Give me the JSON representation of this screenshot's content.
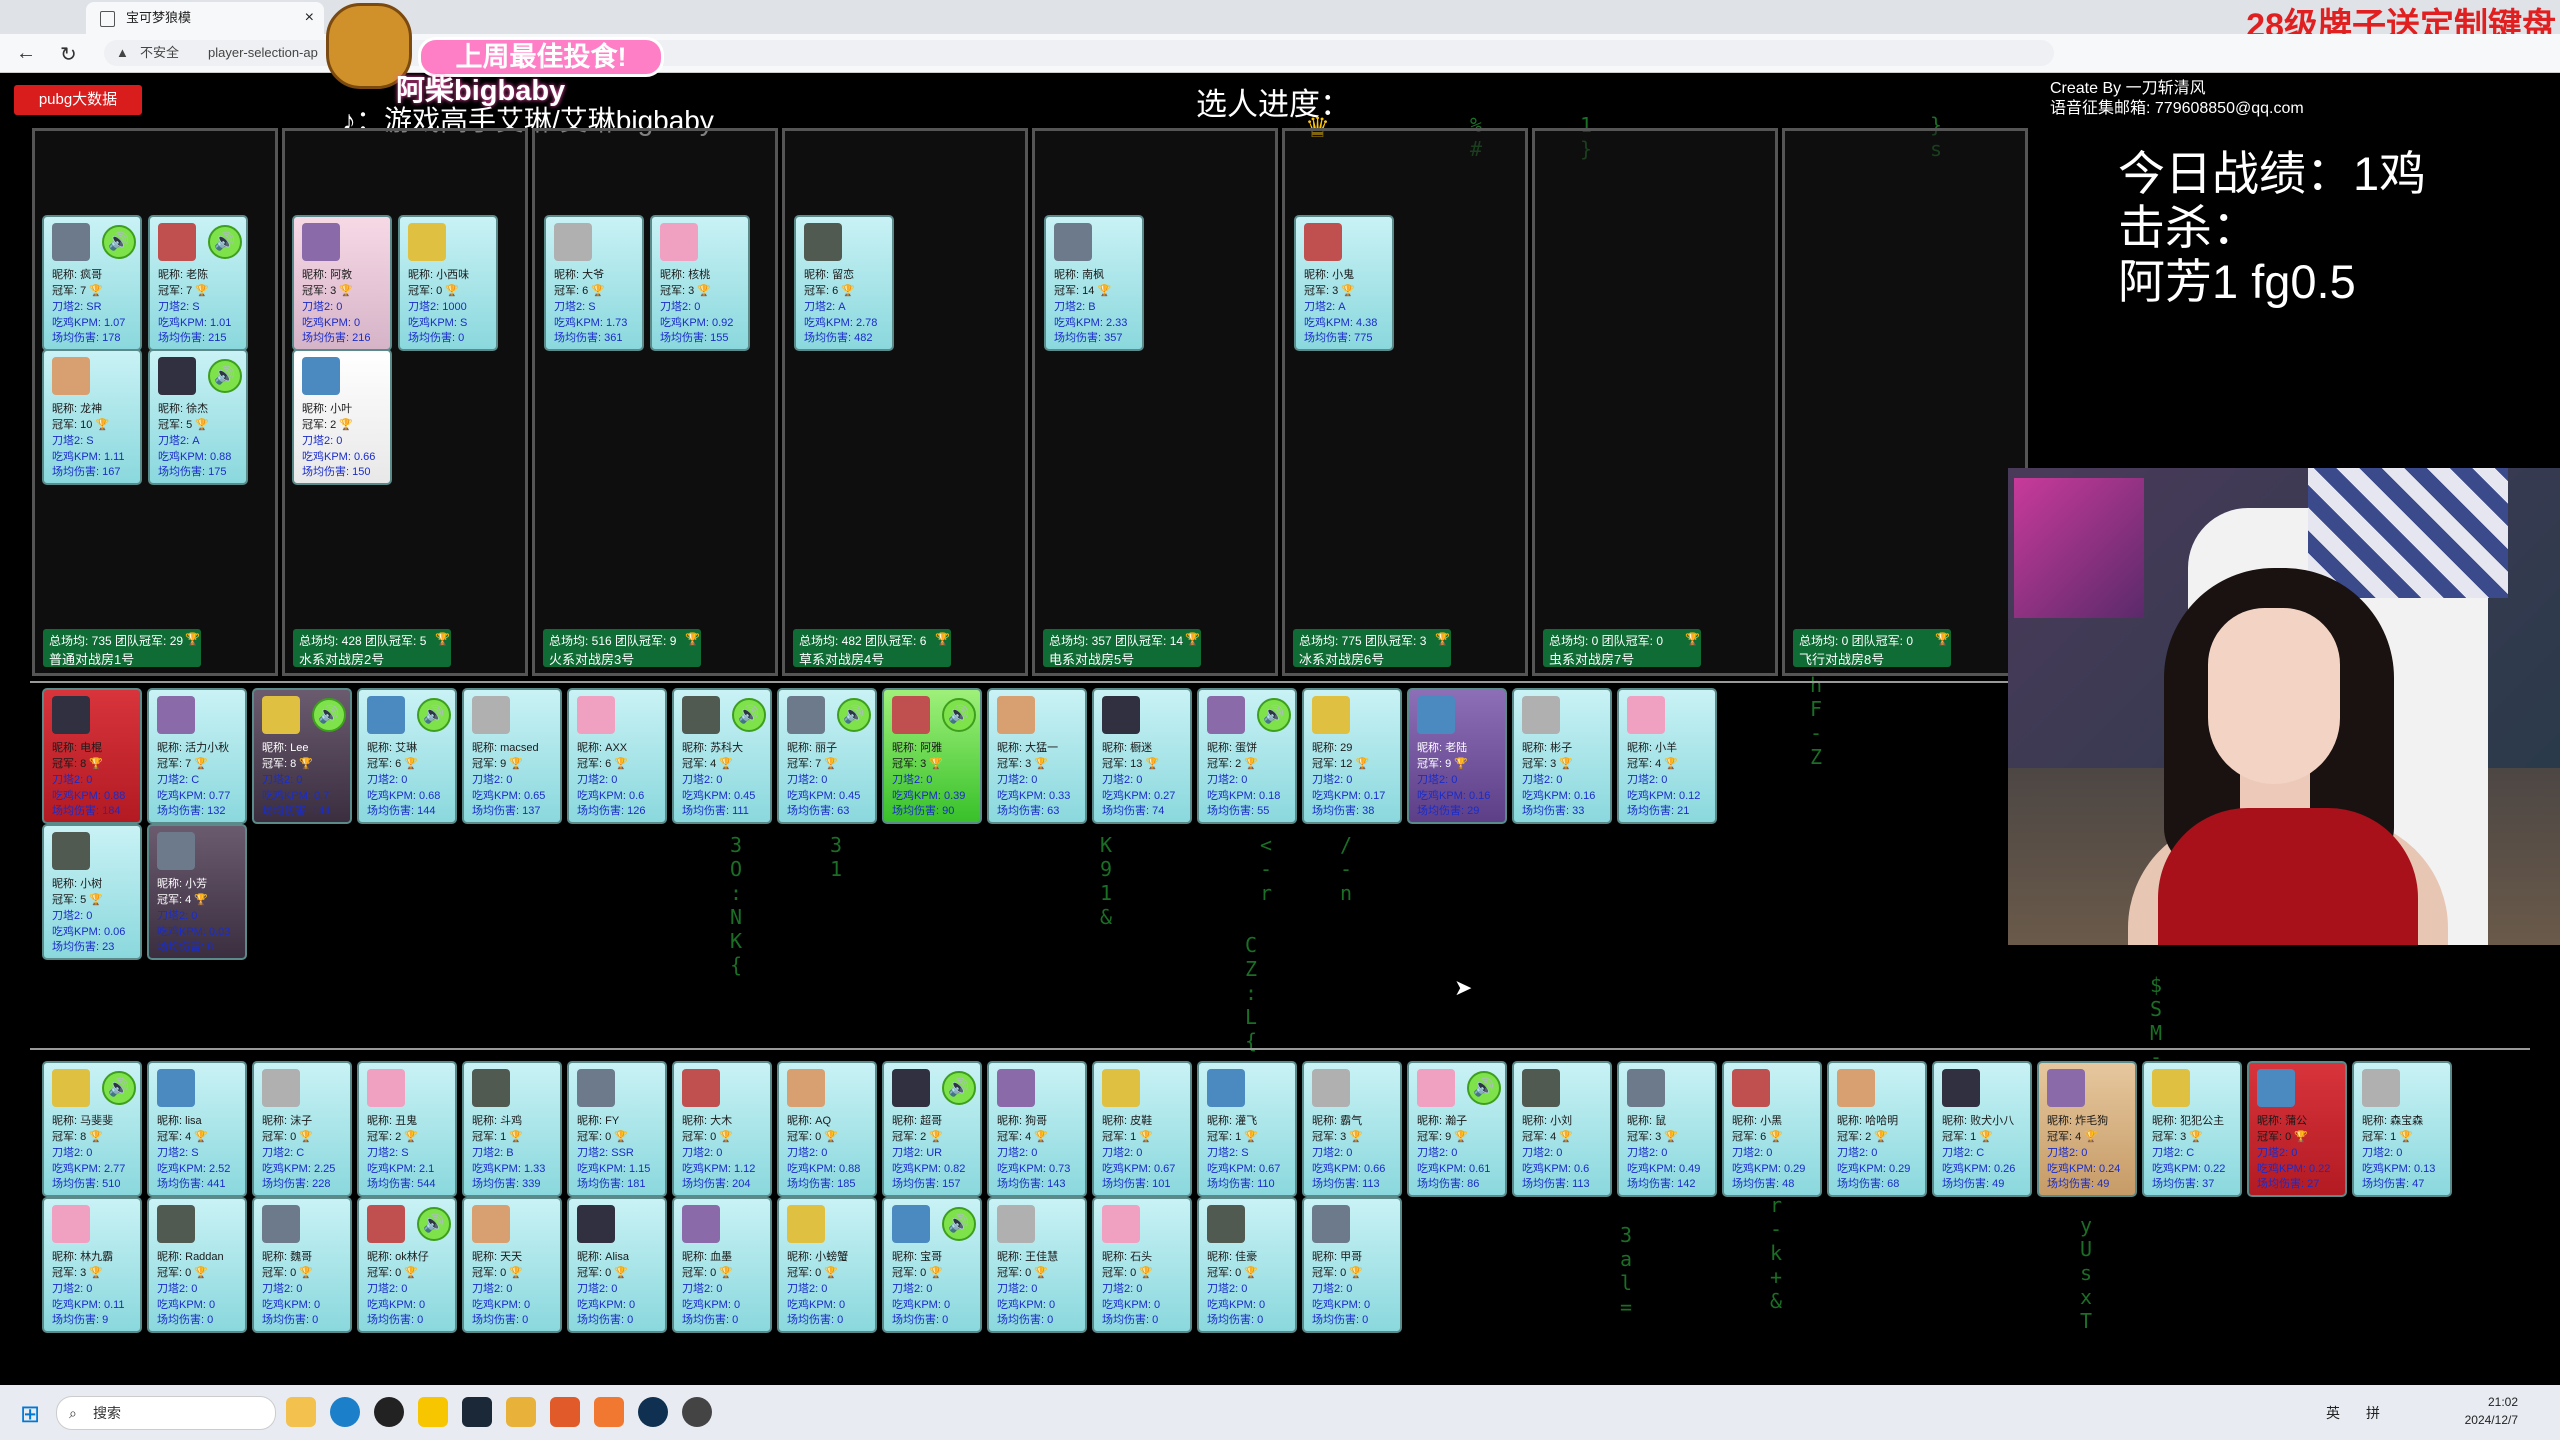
{
  "browser": {
    "tab_title": "宝可梦狼模",
    "tab_close": "×",
    "back": "←",
    "reload": "↻",
    "security_warning": "▲",
    "security_text": "不安全",
    "url": "player-selection-ap",
    "promo_text": "28级牌子送定制键盘"
  },
  "sticker": {
    "title": "上周最佳投食!",
    "name": "阿柴bigbaby",
    "subtitle": "：游戏高手艾琳/艾琳bigbaby",
    "tiktok_icon": "♪"
  },
  "header": {
    "pubg_button": "pubg大数据",
    "progress_label": "选人进度：",
    "crown_icon": "♛",
    "credit_line1": "Create By 一刀斩清风",
    "credit_line2": "语音征集邮箱: 779608850@qq.com",
    "stats_line1": "今日战绩：1鸡",
    "stats_line2": "击杀：",
    "stats_line3": "阿芳1 fg0.5"
  },
  "labels": {
    "nick": "昵称: ",
    "champ": "冠军: ",
    "knife": "刀塔2: ",
    "kpm": "吃鸡KPM: ",
    "dmg": "场均伤害: ",
    "trophy": "🏆",
    "speaker": "🔊"
  },
  "rooms": [
    {
      "name": "普通对战房1号",
      "summary": "总场均: 735 团队冠军: 29"
    },
    {
      "name": "水系对战房2号",
      "summary": "总场均: 428 团队冠军: 5"
    },
    {
      "name": "火系对战房3号",
      "summary": "总场均: 516 团队冠军: 9"
    },
    {
      "name": "草系对战房4号",
      "summary": "总场均: 482 团队冠军: 6"
    },
    {
      "name": "电系对战房5号",
      "summary": "总场均: 357 团队冠军: 14"
    },
    {
      "name": "冰系对战房6号",
      "summary": "总场均: 775 团队冠军: 3"
    },
    {
      "name": "虫系对战房7号",
      "summary": "总场均: 0 团队冠军: 0"
    },
    {
      "name": "飞行对战房8号",
      "summary": "总场均: 0 团队冠军: 0"
    }
  ],
  "room_players": [
    {
      "n": "疯哥",
      "c": "7",
      "k": "SR",
      "kpm": "1.07",
      "d": "178",
      "spk": true
    },
    {
      "n": "老陈",
      "c": "7",
      "k": "S",
      "kpm": "1.01",
      "d": "215",
      "spk": true
    },
    {
      "n": "龙神",
      "c": "10",
      "k": "S",
      "kpm": "1.11",
      "d": "167",
      "spk": false
    },
    {
      "n": "徐杰",
      "c": "5",
      "k": "A",
      "kpm": "0.88",
      "d": "175",
      "spk": true
    },
    {
      "n": "阿敦",
      "c": "3",
      "k": "0",
      "kpm": "0",
      "d": "216",
      "spk": false
    },
    {
      "n": "小西味",
      "c": "0",
      "k": "1000",
      "kpm": "S",
      "d": "0",
      "spk": false
    },
    {
      "n": "小叶",
      "c": "2",
      "k": "0",
      "kpm": "0.66",
      "d": "150",
      "spk": false
    },
    {
      "n": "大爷",
      "c": "6",
      "k": "S",
      "kpm": "1.73",
      "d": "361",
      "spk": false
    },
    {
      "n": "核桃",
      "c": "3",
      "k": "0",
      "kpm": "0.92",
      "d": "155",
      "spk": false
    },
    {
      "n": "留恋",
      "c": "6",
      "k": "A",
      "kpm": "2.78",
      "d": "482",
      "spk": false
    },
    {
      "n": "南枫",
      "c": "14",
      "k": "B",
      "kpm": "2.33",
      "d": "357",
      "spk": false
    },
    {
      "n": "小鬼",
      "c": "3",
      "k": "A",
      "kpm": "4.38",
      "d": "775",
      "spk": false
    }
  ],
  "row2": [
    {
      "n": "电棍",
      "c": "8",
      "k": "0",
      "kpm": "0.88",
      "d": "184",
      "spk": false
    },
    {
      "n": "活力小秋",
      "c": "7",
      "k": "C",
      "kpm": "0.77",
      "d": "132",
      "spk": false
    },
    {
      "n": "Lee",
      "c": "8",
      "k": "0",
      "kpm": "0.7",
      "d": "144",
      "spk": true
    },
    {
      "n": "艾琳",
      "c": "6",
      "k": "0",
      "kpm": "0.68",
      "d": "144",
      "spk": true
    },
    {
      "n": "macsed",
      "c": "9",
      "k": "0",
      "kpm": "0.65",
      "d": "137",
      "spk": false
    },
    {
      "n": "AXX",
      "c": "6",
      "k": "0",
      "kpm": "0.6",
      "d": "126",
      "spk": false
    },
    {
      "n": "苏科大",
      "c": "4",
      "k": "0",
      "kpm": "0.45",
      "d": "111",
      "spk": true
    },
    {
      "n": "丽子",
      "c": "7",
      "k": "0",
      "kpm": "0.45",
      "d": "63",
      "spk": true
    },
    {
      "n": "阿雅",
      "c": "3",
      "k": "0",
      "kpm": "0.39",
      "d": "90",
      "spk": true
    },
    {
      "n": "大猛一",
      "c": "3",
      "k": "0",
      "kpm": "0.33",
      "d": "63",
      "spk": false
    },
    {
      "n": "橱迷",
      "c": "13",
      "k": "0",
      "kpm": "0.27",
      "d": "74",
      "spk": false
    },
    {
      "n": "蛋饼",
      "c": "2",
      "k": "0",
      "kpm": "0.18",
      "d": "55",
      "spk": true
    },
    {
      "n": "29",
      "c": "12",
      "k": "0",
      "kpm": "0.17",
      "d": "38",
      "spk": false
    },
    {
      "n": "老陆",
      "c": "9",
      "k": "0",
      "kpm": "0.16",
      "d": "29",
      "spk": false
    },
    {
      "n": "彬子",
      "c": "3",
      "k": "0",
      "kpm": "0.16",
      "d": "33",
      "spk": false
    },
    {
      "n": "小羊",
      "c": "4",
      "k": "0",
      "kpm": "0.12",
      "d": "21",
      "spk": false
    },
    {
      "n": "小树",
      "c": "5",
      "k": "0",
      "kpm": "0.06",
      "d": "23",
      "spk": false
    },
    {
      "n": "小芳",
      "c": "4",
      "k": "0",
      "kpm": "0.03",
      "d": "8",
      "spk": false
    }
  ],
  "row3": [
    {
      "n": "马斐斐",
      "c": "8",
      "k": "0",
      "kpm": "2.77",
      "d": "510",
      "spk": true
    },
    {
      "n": "lisa",
      "c": "4",
      "k": "S",
      "kpm": "2.52",
      "d": "441",
      "spk": false
    },
    {
      "n": "沫子",
      "c": "0",
      "k": "C",
      "kpm": "2.25",
      "d": "228",
      "spk": false
    },
    {
      "n": "丑鬼",
      "c": "2",
      "k": "S",
      "kpm": "2.1",
      "d": "544",
      "spk": false
    },
    {
      "n": "斗鸡",
      "c": "1",
      "k": "B",
      "kpm": "1.33",
      "d": "339",
      "spk": false
    },
    {
      "n": "FY",
      "c": "0",
      "k": "SSR",
      "kpm": "1.15",
      "d": "181",
      "spk": false
    },
    {
      "n": "大木",
      "c": "0",
      "k": "0",
      "kpm": "1.12",
      "d": "204",
      "spk": false
    },
    {
      "n": "AQ",
      "c": "0",
      "k": "0",
      "kpm": "0.88",
      "d": "185",
      "spk": false
    },
    {
      "n": "超哥",
      "c": "2",
      "k": "UR",
      "kpm": "0.82",
      "d": "157",
      "spk": true
    },
    {
      "n": "狗哥",
      "c": "4",
      "k": "0",
      "kpm": "0.73",
      "d": "143",
      "spk": false
    },
    {
      "n": "皮鞋",
      "c": "1",
      "k": "0",
      "kpm": "0.67",
      "d": "101",
      "spk": false
    },
    {
      "n": "灌飞",
      "c": "1",
      "k": "S",
      "kpm": "0.67",
      "d": "110",
      "spk": false
    },
    {
      "n": "霸气",
      "c": "3",
      "k": "0",
      "kpm": "0.66",
      "d": "113",
      "spk": false
    },
    {
      "n": "瀚子",
      "c": "9",
      "k": "0",
      "kpm": "0.61",
      "d": "86",
      "spk": true
    },
    {
      "n": "小刘",
      "c": "4",
      "k": "0",
      "kpm": "0.6",
      "d": "113",
      "spk": false
    },
    {
      "n": "鼠",
      "c": "3",
      "k": "0",
      "kpm": "0.49",
      "d": "142",
      "spk": false
    },
    {
      "n": "小黑",
      "c": "6",
      "k": "0",
      "kpm": "0.29",
      "d": "48",
      "spk": false
    },
    {
      "n": "哈哈明",
      "c": "2",
      "k": "0",
      "kpm": "0.29",
      "d": "68",
      "spk": false
    },
    {
      "n": "败犬小八",
      "c": "1",
      "k": "C",
      "kpm": "0.26",
      "d": "49",
      "spk": false
    },
    {
      "n": "炸毛狗",
      "c": "4",
      "k": "0",
      "kpm": "0.24",
      "d": "49",
      "spk": false
    },
    {
      "n": "犯犯公主",
      "c": "3",
      "k": "C",
      "kpm": "0.22",
      "d": "37",
      "spk": false
    },
    {
      "n": "蒲公",
      "c": "0",
      "k": "0",
      "kpm": "0.22",
      "d": "27",
      "spk": false
    },
    {
      "n": "森宝森",
      "c": "1",
      "k": "0",
      "kpm": "0.13",
      "d": "47",
      "spk": false
    },
    {
      "n": "林九霸",
      "c": "3",
      "k": "0",
      "kpm": "0.11",
      "d": "9",
      "spk": false
    },
    {
      "n": "Raddan",
      "c": "0",
      "k": "0",
      "kpm": "0",
      "d": "0",
      "spk": false
    },
    {
      "n": "魏哥",
      "c": "0",
      "k": "0",
      "kpm": "0",
      "d": "0",
      "spk": false
    },
    {
      "n": "ok林仔",
      "c": "0",
      "k": "0",
      "kpm": "0",
      "d": "0",
      "spk": true
    },
    {
      "n": "天天",
      "c": "0",
      "k": "0",
      "kpm": "0",
      "d": "0",
      "spk": false
    },
    {
      "n": "Alisa",
      "c": "0",
      "k": "0",
      "kpm": "0",
      "d": "0",
      "spk": false
    },
    {
      "n": "血墨",
      "c": "0",
      "k": "0",
      "kpm": "0",
      "d": "0",
      "spk": false
    },
    {
      "n": "小螃蟹",
      "c": "0",
      "k": "0",
      "kpm": "0",
      "d": "0",
      "spk": false
    },
    {
      "n": "宝哥",
      "c": "0",
      "k": "0",
      "kpm": "0",
      "d": "0",
      "spk": true
    },
    {
      "n": "王佳慧",
      "c": "0",
      "k": "0",
      "kpm": "0",
      "d": "0",
      "spk": false
    },
    {
      "n": "石头",
      "c": "0",
      "k": "0",
      "kpm": "0",
      "d": "0",
      "spk": false
    },
    {
      "n": "佳豪",
      "c": "0",
      "k": "0",
      "kpm": "0",
      "d": "0",
      "spk": false
    },
    {
      "n": "甲哥",
      "c": "0",
      "k": "0",
      "kpm": "0",
      "d": "0",
      "spk": false
    }
  ],
  "taskbar": {
    "search": "搜索",
    "search_icon": "⌕",
    "windows_icon": "⊞",
    "ime1": "英",
    "ime2": "拼",
    "time": "21:02",
    "date": "2024/12/7"
  },
  "colors": {
    "accent_green": "#0f6c35",
    "card_cyan": "#8ad8dd",
    "pubg_red": "#d91d1d",
    "promo_red": "#e02020"
  }
}
